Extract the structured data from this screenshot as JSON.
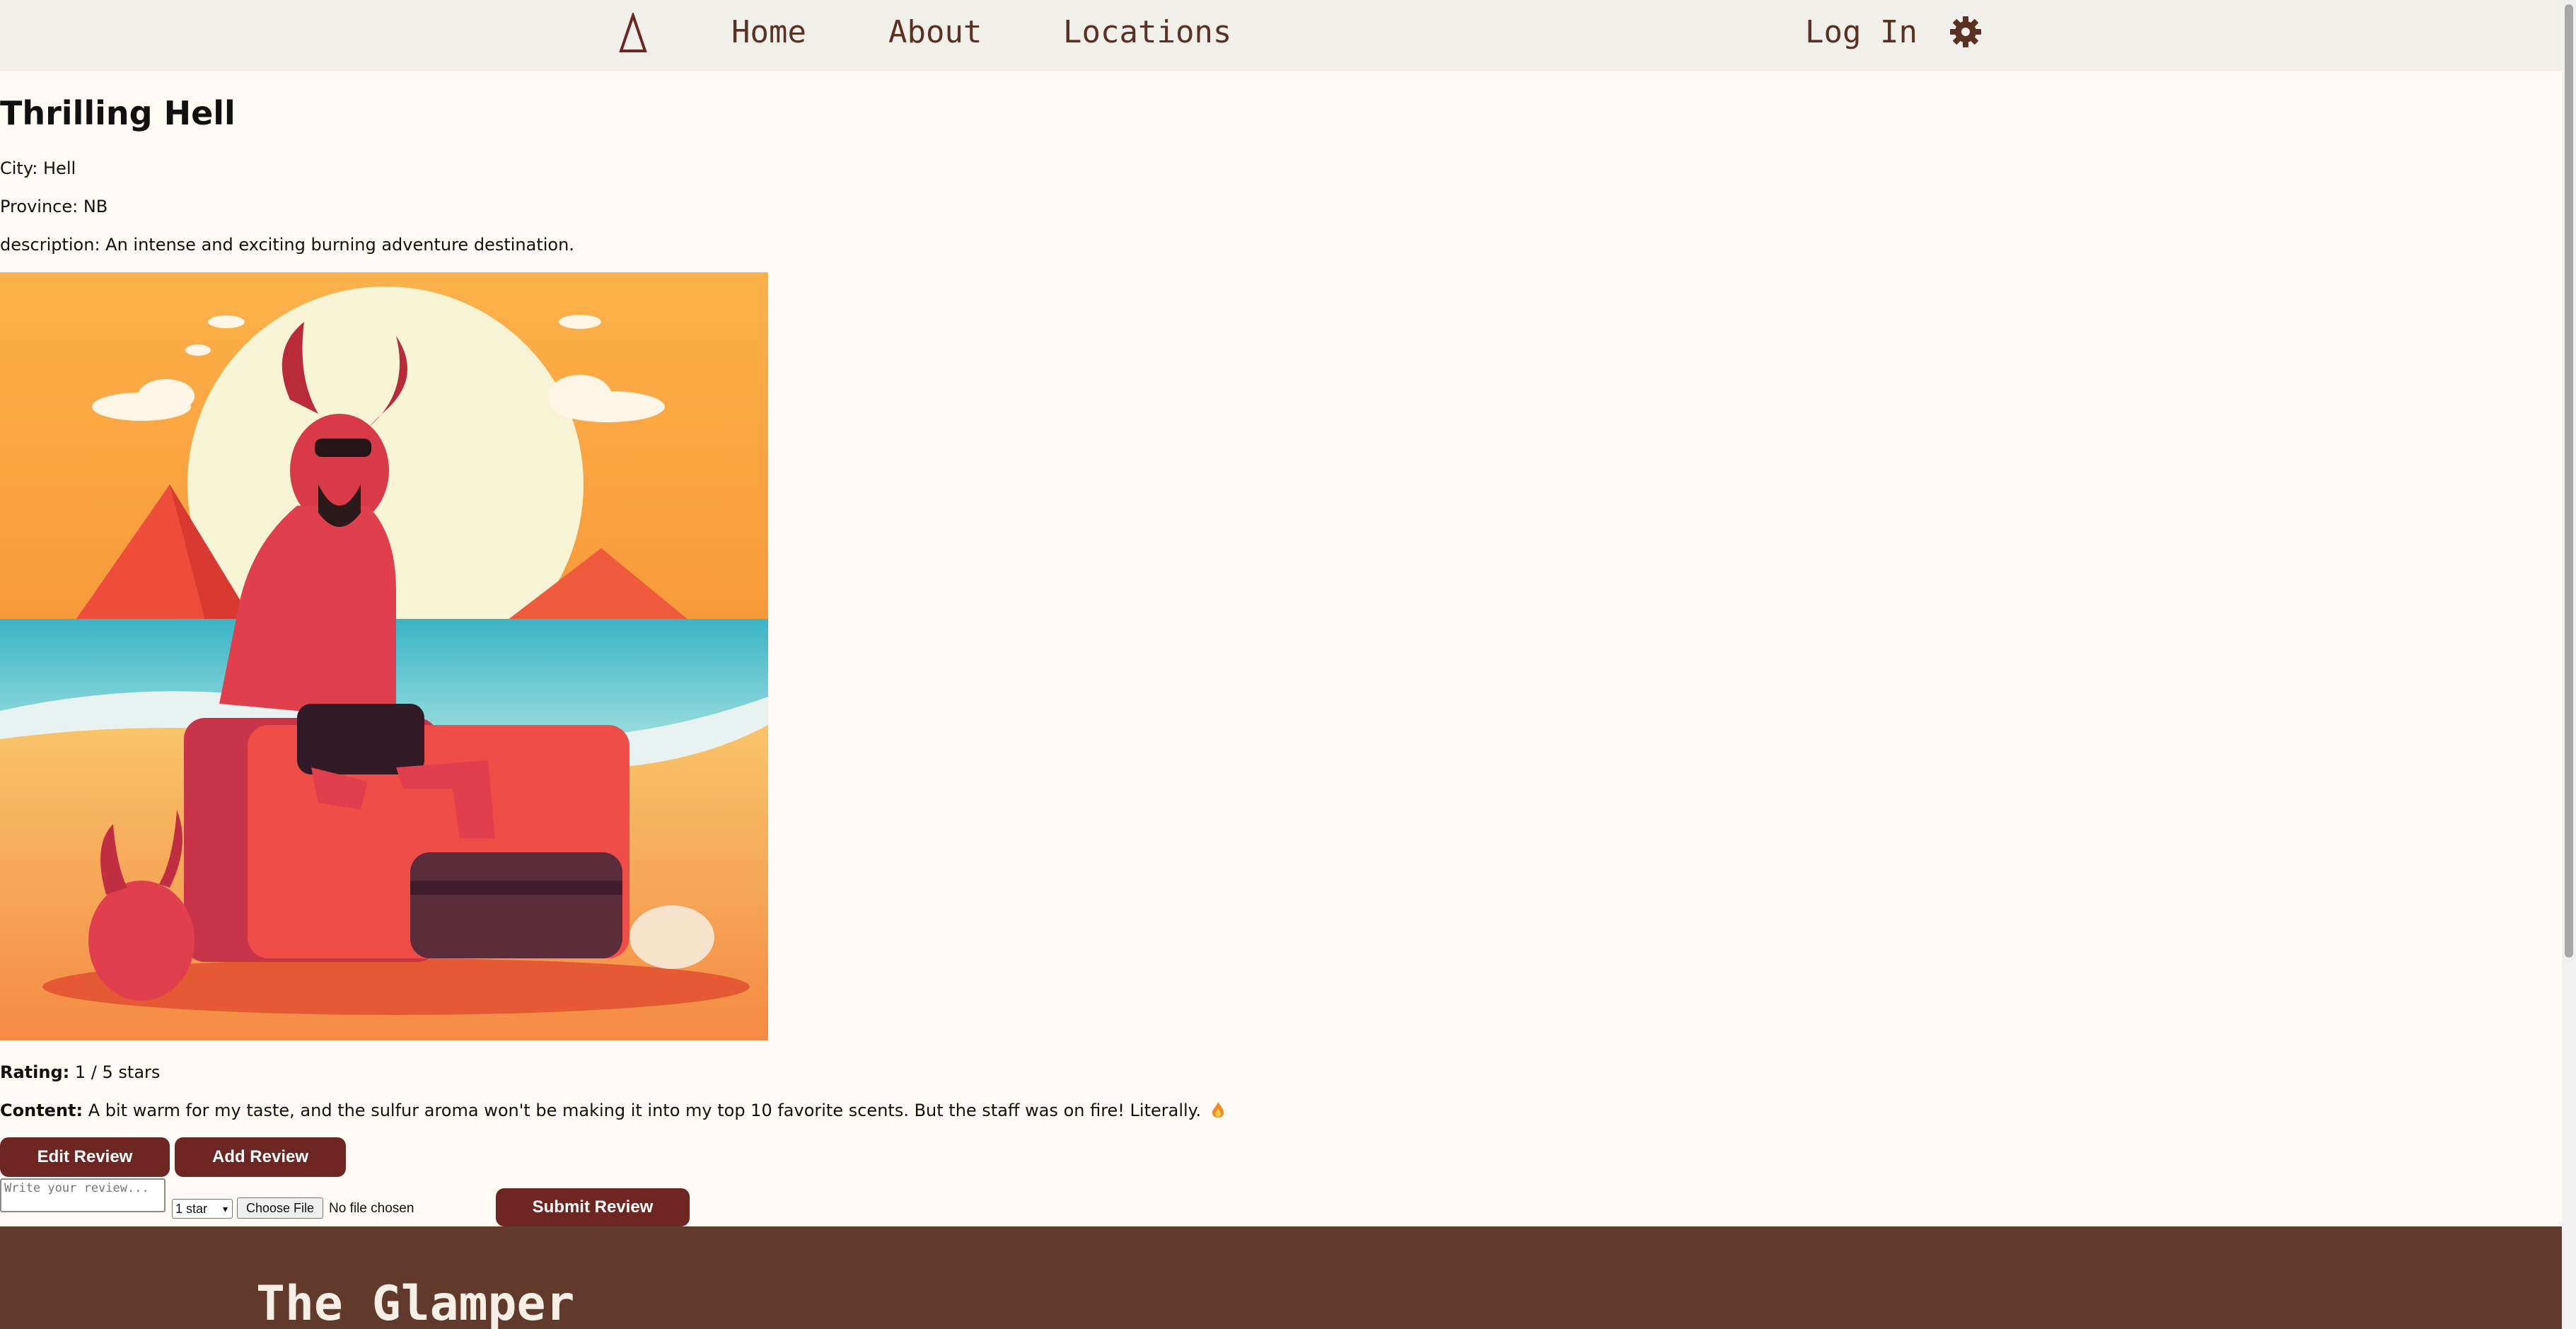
{
  "nav": {
    "logo_icon": "delta-triangle-icon",
    "home": "Home",
    "about": "About",
    "locations": "Locations",
    "login": "Log In",
    "settings_icon": "gear-icon"
  },
  "location": {
    "title": "Thrilling Hell",
    "city": "City: Hell",
    "province": "Province: NB",
    "description": "description: An intense and exciting burning adventure destination."
  },
  "review": {
    "rating_label": "Rating:",
    "rating_value": "1 / 5 stars",
    "content_label": "Content:",
    "content_value": "A bit warm for my taste, and the sulfur aroma won't be making it into my top 10 favorite scents. But the staff was on fire! Literally.",
    "content_icon": "flame-icon"
  },
  "buttons": {
    "edit": "Edit Review",
    "add": "Add Review",
    "submit": "Submit Review"
  },
  "form": {
    "review_placeholder": "Write your review...",
    "star_selected": "1 star",
    "choose_file": "Choose File",
    "file_status": "No file chosen"
  },
  "footer": {
    "title": "The Glamper"
  },
  "colors": {
    "accent": "#6e2622",
    "footer_bg": "#623a2b",
    "nav_text": "#5a3224",
    "page_bg": "#fffbf4"
  }
}
